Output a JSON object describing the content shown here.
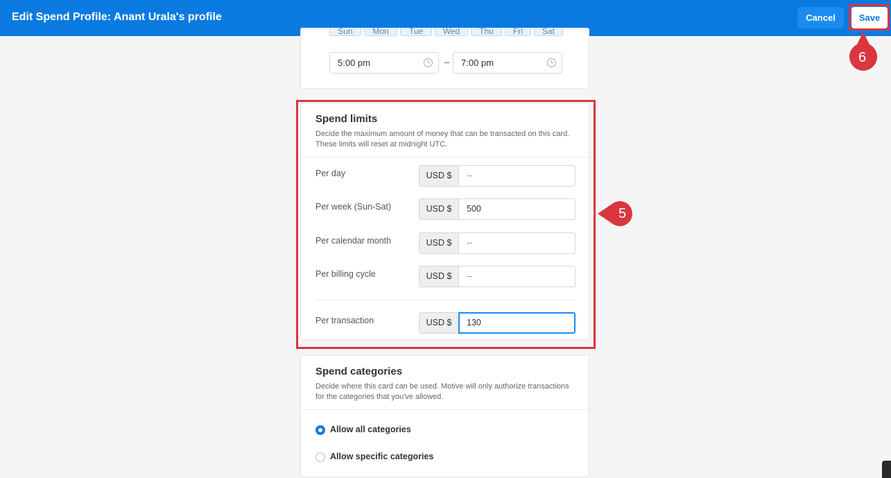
{
  "header": {
    "title": "Edit Spend Profile: Anant Urala's profile",
    "cancel_label": "Cancel",
    "save_label": "Save"
  },
  "schedule": {
    "days": [
      "Sun",
      "Mon",
      "Tue",
      "Wed",
      "Thu",
      "Fri",
      "Sat"
    ],
    "start_time": "5:00 pm",
    "separator": "–",
    "end_time": "7:00 pm"
  },
  "spend_limits": {
    "title": "Spend limits",
    "description_line1": "Decide the maximum amount of money that can be transacted on this card.",
    "description_line2": "These limits will reset at midnight UTC.",
    "rows": [
      {
        "label": "Per day",
        "currency": "USD $",
        "value": "--"
      },
      {
        "label": "Per week (Sun-Sat)",
        "currency": "USD $",
        "value": "500"
      },
      {
        "label": "Per calendar month",
        "currency": "USD $",
        "value": "--"
      },
      {
        "label": "Per billing cycle",
        "currency": "USD $",
        "value": "--"
      },
      {
        "label": "Per transaction",
        "currency": "USD $",
        "value": "130"
      }
    ]
  },
  "spend_categories": {
    "title": "Spend categories",
    "description_line1": "Decide where this card can be used. Motive will only authorize transactions",
    "description_line2": "for the categories that you've allowed.",
    "options": [
      {
        "label": "Allow all categories",
        "selected": true
      },
      {
        "label": "Allow specific categories",
        "selected": false
      }
    ]
  },
  "annotations": {
    "step5": "5",
    "step6": "6",
    "marker_color": "#d9363e"
  },
  "colors": {
    "header_bg": "#0b7ae0",
    "accent": "#1a8cf0"
  }
}
